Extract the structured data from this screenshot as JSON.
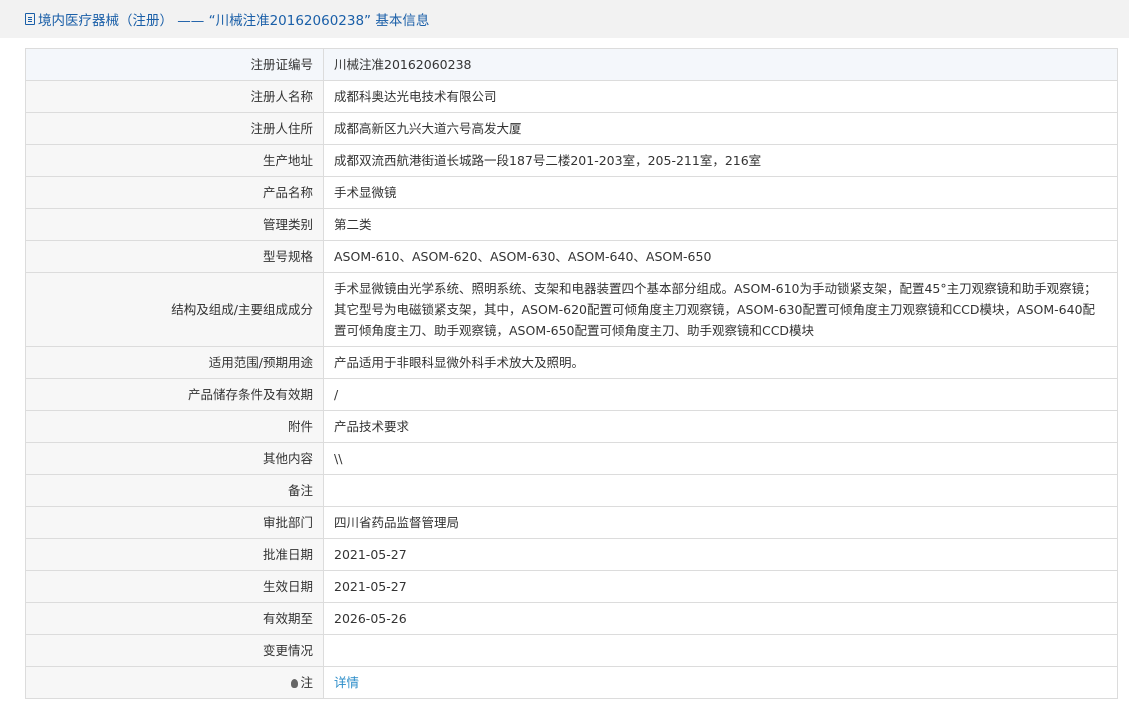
{
  "header": {
    "icon": "document-icon",
    "title": "境内医疗器械（注册） —— “川械注准20162060238” 基本信息",
    "title_color": "#1a5fa8"
  },
  "rows": [
    {
      "label": "注册证编号",
      "value": "川械注准20162060238"
    },
    {
      "label": "注册人名称",
      "value": "成都科奥达光电技术有限公司"
    },
    {
      "label": "注册人住所",
      "value": "成都高新区九兴大道六号高发大厦"
    },
    {
      "label": "生产地址",
      "value": "成都双流西航港街道长城路一段187号二楼201-203室，205-211室，216室"
    },
    {
      "label": "产品名称",
      "value": "手术显微镜"
    },
    {
      "label": "管理类别",
      "value": "第二类"
    },
    {
      "label": "型号规格",
      "value": "ASOM-610、ASOM-620、ASOM-630、ASOM-640、ASOM-650"
    },
    {
      "label": "结构及组成/主要组成成分",
      "value": "手术显微镜由光学系统、照明系统、支架和电器装置四个基本部分组成。ASOM-610为手动锁紧支架，配置45°主刀观察镜和助手观察镜；其它型号为电磁锁紧支架，其中，ASOM-620配置可倾角度主刀观察镜，ASOM-630配置可倾角度主刀观察镜和CCD模块，ASOM-640配置可倾角度主刀、助手观察镜，ASOM-650配置可倾角度主刀、助手观察镜和CCD模块"
    },
    {
      "label": "适用范围/预期用途",
      "value": "产品适用于非眼科显微外科手术放大及照明。"
    },
    {
      "label": "产品储存条件及有效期",
      "value": "/"
    },
    {
      "label": "附件",
      "value": "产品技术要求"
    },
    {
      "label": "其他内容",
      "value": "\\\\"
    },
    {
      "label": "备注",
      "value": ""
    },
    {
      "label": "审批部门",
      "value": "四川省药品监督管理局"
    },
    {
      "label": "批准日期",
      "value": "2021-05-27"
    },
    {
      "label": "生效日期",
      "value": "2021-05-27"
    },
    {
      "label": "有效期至",
      "value": "2026-05-26"
    },
    {
      "label": "变更情况",
      "value": ""
    }
  ],
  "note": {
    "icon": "lightbulb-icon",
    "label": "注",
    "link_text": "详情",
    "link_color": "#2a8cc8"
  }
}
